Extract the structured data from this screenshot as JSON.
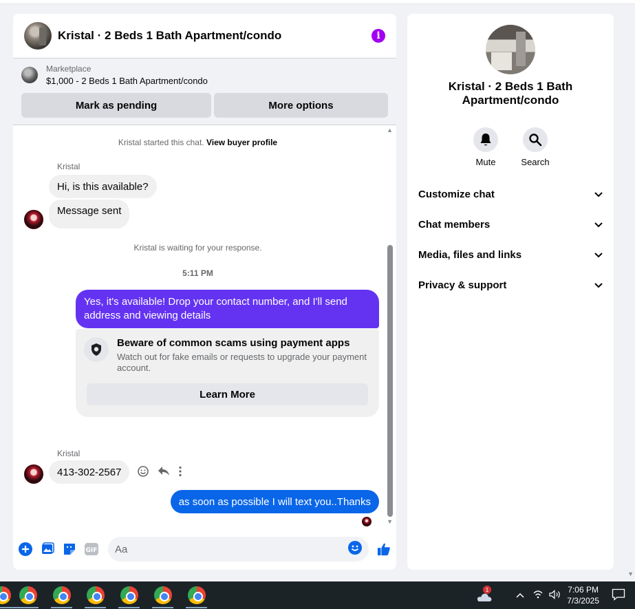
{
  "chat": {
    "title": "Kristal · 2 Beds 1 Bath Apartment/condo",
    "marketplace_label": "Marketplace",
    "listing": "$1,000 - 2 Beds 1 Bath Apartment/condo",
    "mark_pending": "Mark as pending",
    "more_options": "More options",
    "started_text": "Kristal started this chat.",
    "view_profile": "View buyer profile",
    "sender_name": "Kristal",
    "msg1": "Hi, is this available?",
    "msg2": "Message sent",
    "waiting": "Kristal is waiting for your response.",
    "time": "5:11 PM",
    "reply1": "Yes, it's available! Drop your contact number, and I'll send address and viewing details",
    "warning_title": "Beware of common scams using payment apps",
    "warning_body": "Watch out for fake emails or requests to upgrade your payment account.",
    "learn_more": "Learn More",
    "sender_name2": "Kristal",
    "msg3": "413-302-2567",
    "reply2": "as soon as possible I will text you..Thanks",
    "input_placeholder": "Aa"
  },
  "side": {
    "title": "Kristal · 2 Beds 1 Bath Apartment/condo",
    "mute": "Mute",
    "search": "Search",
    "items": [
      {
        "label": "Customize chat"
      },
      {
        "label": "Chat members"
      },
      {
        "label": "Media, files and links"
      },
      {
        "label": "Privacy & support"
      }
    ]
  },
  "taskbar": {
    "time": "7:06 PM",
    "date": "7/3/2025",
    "badge": "1"
  },
  "colors": {
    "accent_purple": "#6433f2",
    "accent_blue": "#0a66e8",
    "info_purple": "#a100f2"
  }
}
